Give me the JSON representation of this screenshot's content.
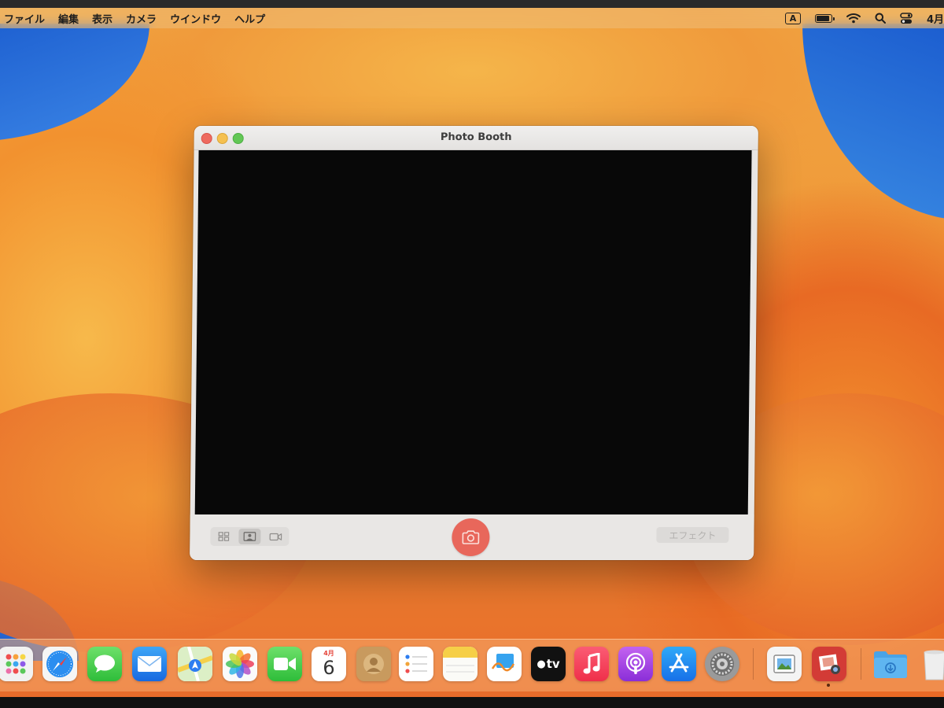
{
  "menubar": {
    "items": [
      "ファイル",
      "編集",
      "表示",
      "カメラ",
      "ウインドウ",
      "ヘルプ"
    ],
    "status": {
      "input_indicator": "A",
      "date": "4月"
    }
  },
  "window": {
    "title": "Photo Booth",
    "toolbar": {
      "effects_label": "エフェクト",
      "modes": [
        "grid-mode",
        "single-photo-mode",
        "video-mode"
      ],
      "active_mode": "single-photo-mode"
    }
  },
  "dock": {
    "calendar": {
      "month": "4月",
      "day": "6"
    },
    "appletv_label": "tv",
    "apps": [
      "launchpad",
      "safari",
      "messages",
      "mail",
      "maps",
      "photos",
      "facetime",
      "calendar",
      "contacts",
      "reminders",
      "notes",
      "freeform",
      "apple-tv",
      "music",
      "podcasts",
      "app-store",
      "system-settings",
      "preview",
      "photo-booth",
      "downloads-folder",
      "trash"
    ]
  },
  "colors": {
    "accent_red": "#e8675b",
    "close": "#ee6a5f",
    "minimize": "#f5c04f",
    "maximize": "#62c755"
  }
}
